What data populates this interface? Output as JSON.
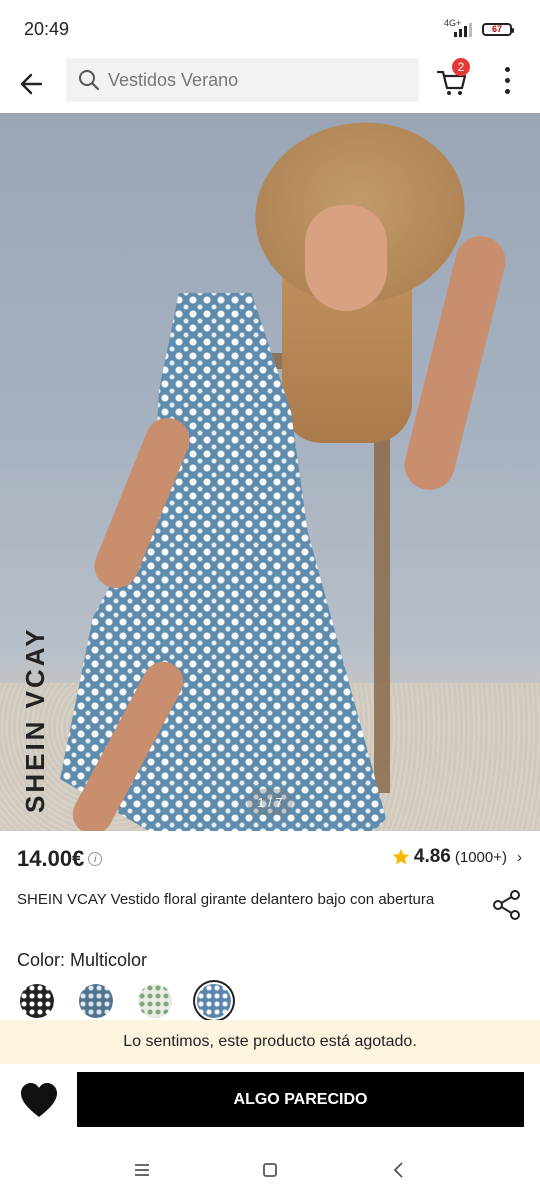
{
  "status_bar": {
    "time": "20:49",
    "network": "4G+",
    "battery": "67"
  },
  "search": {
    "text": "Vestidos Verano"
  },
  "cart": {
    "badge": "2"
  },
  "gallery": {
    "brand": "SHEIN VCAY",
    "pager": "1 / 7"
  },
  "product": {
    "price": "14.00€",
    "rating": "4.86",
    "rating_count": "(1000+)",
    "title": "SHEIN VCAY Vestido floral girante delantero bajo con abertura",
    "color_label": "Color: Multicolor",
    "swatch_selected_index": 3
  },
  "notice": {
    "soldout": "Lo sentimos, este producto está agotado."
  },
  "actions": {
    "similar": "ALGO PARECIDO"
  },
  "colors": {
    "badge": "#e53935",
    "notice_bg": "#fdf4df",
    "button": "#000000",
    "star": "#f5b800"
  },
  "icons": [
    "back-arrow-icon",
    "search-icon",
    "cart-icon",
    "more-icon",
    "info-icon",
    "star-icon",
    "chevron-right-icon",
    "share-icon",
    "heart-icon",
    "menu-icon",
    "home-icon",
    "back-icon"
  ]
}
